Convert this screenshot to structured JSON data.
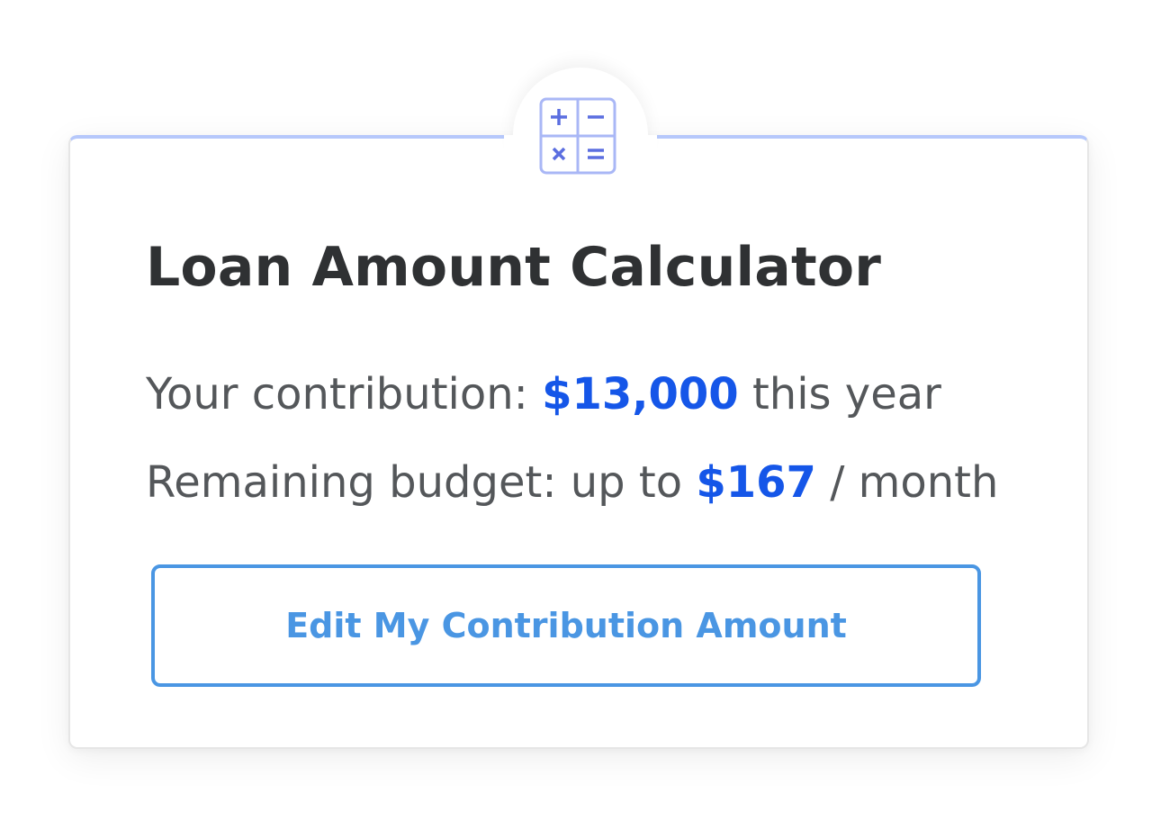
{
  "card": {
    "icon": "calculator-icon",
    "title": "Loan Amount Calculator",
    "contribution": {
      "prefix": "Your contribution: ",
      "amount": "$13,000",
      "suffix": " this year"
    },
    "budget": {
      "prefix": "Remaining budget: up to ",
      "amount": "$167",
      "suffix": " / month"
    },
    "edit_button_label": "Edit My Contribution Amount"
  },
  "colors": {
    "accent_blue": "#1556e8",
    "button_blue": "#4a96e3",
    "icon_blue": "#5b6ee0",
    "card_top_border": "#b6c8fb",
    "title_text": "#2f3133",
    "body_text": "#54575a"
  }
}
